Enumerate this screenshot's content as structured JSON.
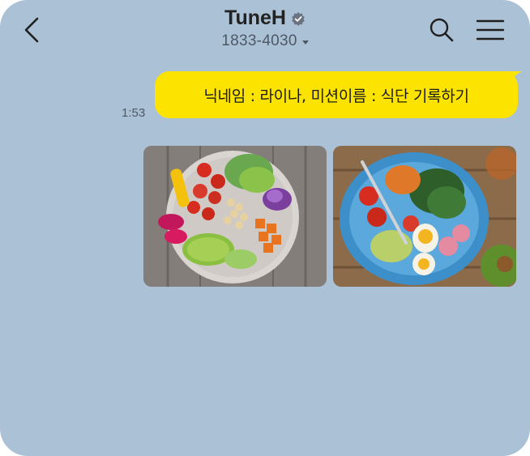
{
  "header": {
    "title": "TuneH",
    "subtitle": "1833-4030",
    "icons": {
      "back": "chevron-left-icon",
      "verified": "verified-badge-icon",
      "dropdown": "caret-down-icon",
      "search": "search-icon",
      "menu": "hamburger-menu-icon"
    }
  },
  "messages": [
    {
      "time": "1:53",
      "text": "닉네임 : 라이나, 미션이름 :  식단 기록하기"
    }
  ],
  "photos": [
    {
      "name": "salad-bowl-photo"
    },
    {
      "name": "egg-salad-bowl-photo"
    }
  ],
  "colors": {
    "background": "#abc1d5",
    "bubble": "#fde300",
    "text": "#222222"
  }
}
